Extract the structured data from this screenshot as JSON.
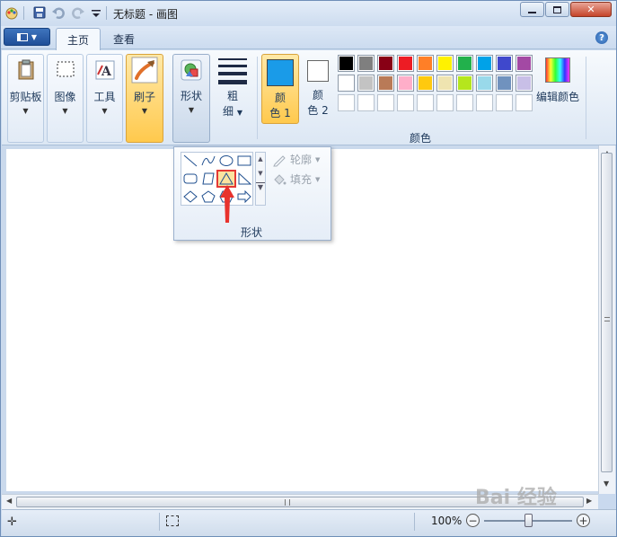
{
  "window": {
    "title": "无标题 - 画图",
    "controls": [
      "minimize",
      "maximize",
      "close"
    ]
  },
  "menu": {
    "tabs": [
      {
        "label": "主页",
        "active": true
      },
      {
        "label": "查看",
        "active": false
      }
    ],
    "help_label": "?"
  },
  "ribbon": {
    "clipboard_label": "剪贴板",
    "image_label": "图像",
    "tools_label": "工具",
    "brushes_label": "刷子",
    "shapes_label": "形状",
    "size_label_1": "粗",
    "size_label_2": "细",
    "color1_label_1": "颜",
    "color1_label_2": "色 1",
    "color2_label_1": "颜",
    "color2_label_2": "色 2",
    "edit_colors_label": "编辑颜色",
    "colors_group_label": "颜色"
  },
  "colors": {
    "color1": "#1a9be8",
    "color2": "#ffffff",
    "row1": [
      "#000000",
      "#7f7f7f",
      "#880015",
      "#ed1c24",
      "#ff7f27",
      "#fff200",
      "#22b14c",
      "#00a2e8",
      "#3f48cc",
      "#a349a4"
    ],
    "row2": [
      "#ffffff",
      "#c3c3c3",
      "#b97a57",
      "#ffaec9",
      "#ffc90e",
      "#efe4b0",
      "#b5e61d",
      "#99d9ea",
      "#7092be",
      "#c8bfe7"
    ],
    "row3": [
      "#ffffff",
      "#ffffff",
      "#ffffff",
      "#ffffff",
      "#ffffff",
      "#ffffff",
      "#ffffff",
      "#ffffff",
      "#ffffff",
      "#ffffff"
    ]
  },
  "shapes_dropdown": {
    "outline_label": "轮廓",
    "fill_label": "填充",
    "group_label": "形状"
  },
  "status": {
    "zoom": "100%"
  },
  "watermark": "Bai 经验"
}
